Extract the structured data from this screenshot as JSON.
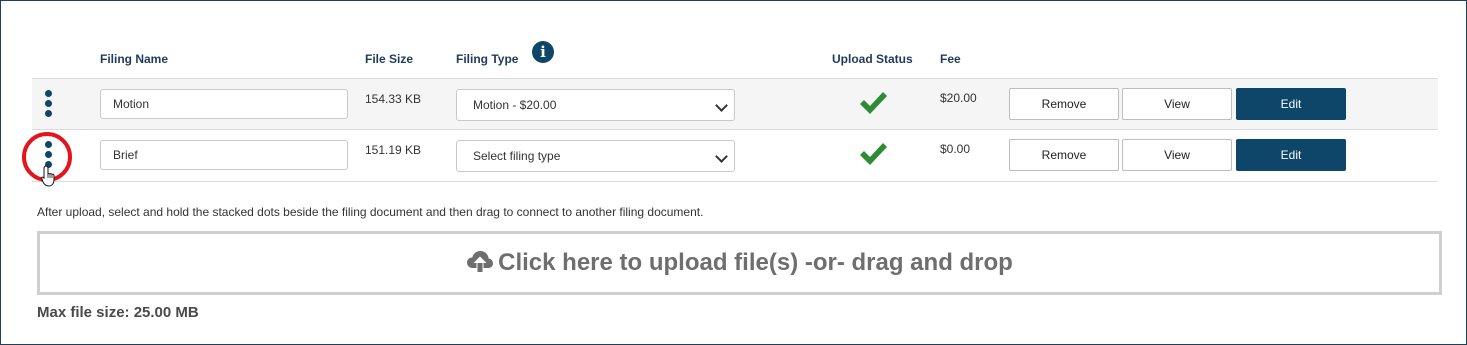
{
  "table": {
    "headers": {
      "filing_name": "Filing Name",
      "file_size": "File Size",
      "filing_type": "Filing Type",
      "upload_status": "Upload Status",
      "fee": "Fee"
    },
    "rows": [
      {
        "filing_name": "Motion",
        "file_size": "154.33 KB",
        "filing_type": "Motion - $20.00",
        "upload_status": "check-icon",
        "fee": "$20.00",
        "remove_label": "Remove",
        "view_label": "View",
        "edit_label": "Edit"
      },
      {
        "filing_name": "Brief",
        "file_size": "151.19 KB",
        "filing_type": "Select filing type",
        "upload_status": "check-icon",
        "fee": "$0.00",
        "remove_label": "Remove",
        "view_label": "View",
        "edit_label": "Edit"
      }
    ]
  },
  "help_text": "After upload, select and hold the stacked dots beside the filing document and then drag to connect to another filing document.",
  "upload": {
    "label": "Click here to upload file(s) -or- drag and drop",
    "icon": "cloud-upload-icon"
  },
  "max_file_size": "Max file size: 25.00 MB",
  "colors": {
    "primary": "#0d4668",
    "success": "#2e8b36",
    "highlight": "#e3141b"
  }
}
